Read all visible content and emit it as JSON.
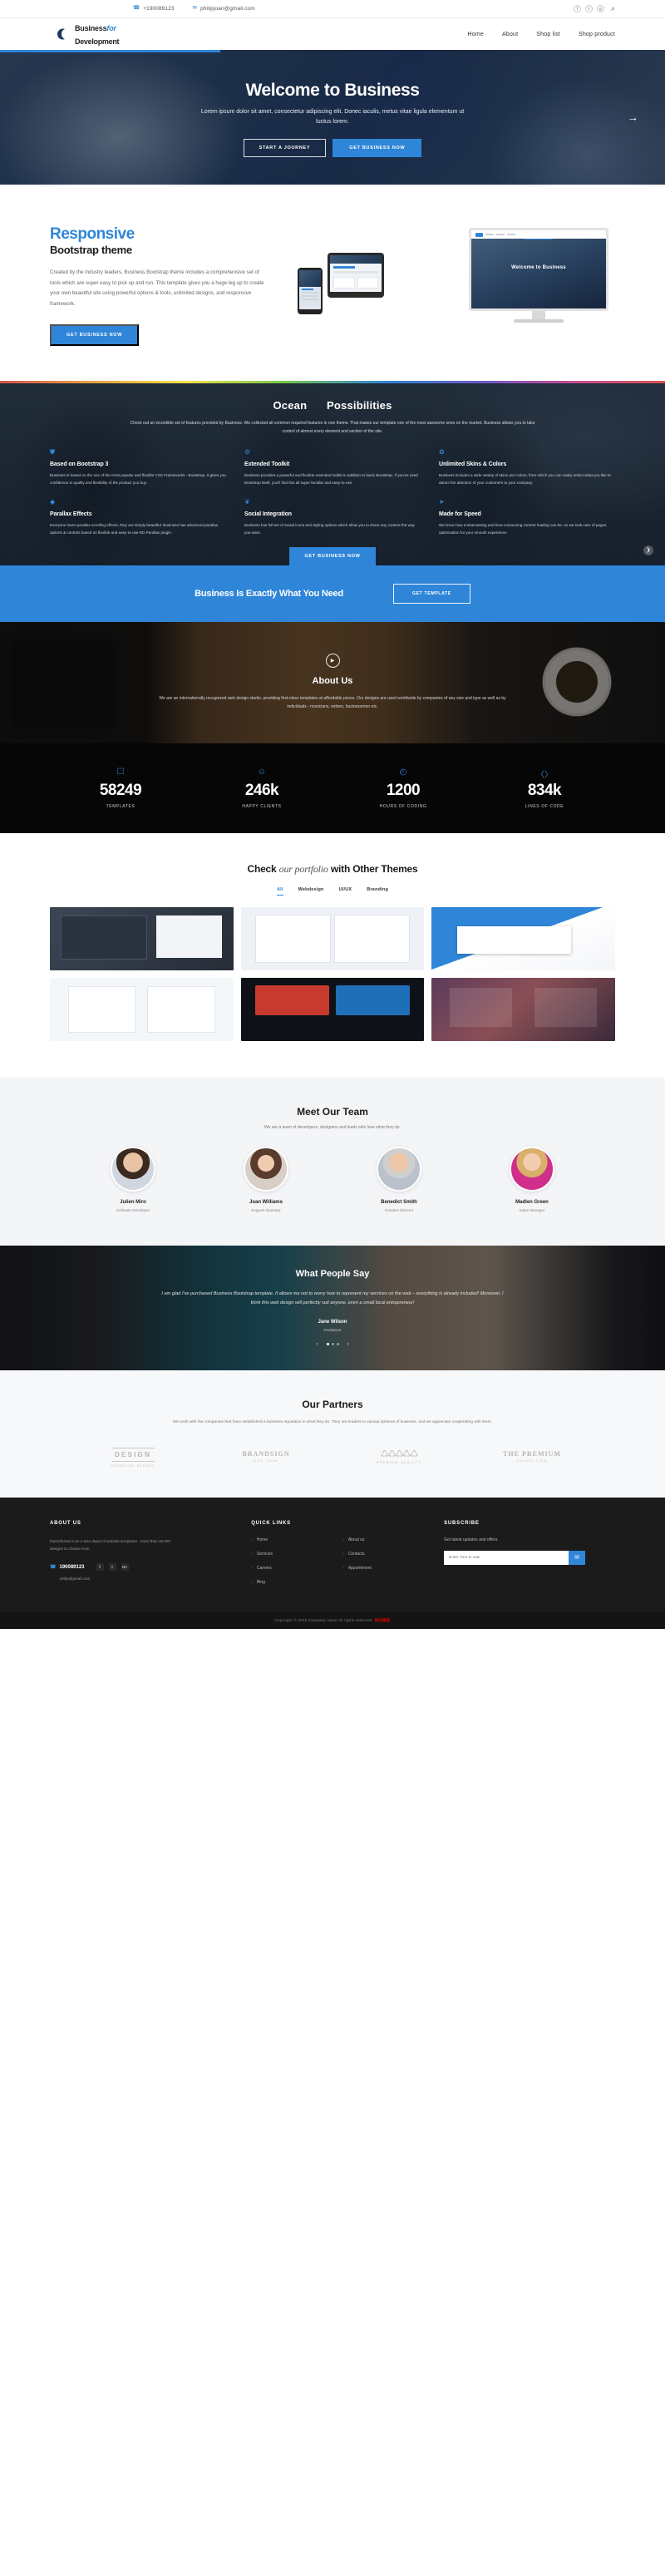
{
  "topbar": {
    "phone": "+190089123",
    "email": "philipjoan@gmail.com",
    "phone_icon": "phone-icon",
    "mail_icon": "envelope-icon",
    "socials": [
      {
        "name": "facebook",
        "glyph": "f"
      },
      {
        "name": "twitter",
        "glyph": "t"
      },
      {
        "name": "google-plus",
        "glyph": "g"
      }
    ],
    "search_glyph": "⌕"
  },
  "nav": {
    "brand_line1": "Business",
    "brand_italic": "for",
    "brand_line2": "Development",
    "links": [
      "Home",
      "About",
      "Shop list",
      "Shop product"
    ]
  },
  "hero": {
    "title": "Welcome to Business",
    "subtitle": "Lorem ipsum dolor sit amet, consectetur adipiscing elit. Donec iaculis, metus vitae ligula elementum ut luctus lorem.",
    "btn_ghost": "START A JOURNEY",
    "btn_primary": "GET BUSINESS NOW",
    "arrow_glyph": "→"
  },
  "responsive": {
    "title_blue": "Responsive",
    "title_dark": "Bootstrap theme",
    "paragraph": "Created by the industry leaders, Business Bootstrap theme includes a comprehensive set of tools which are super easy to pick up and run. This template gives you a huge leg up to create your own beautiful site using powerful options & tools, unlimited designs, and responsive framework.",
    "button": "GET BUSINESS NOW",
    "monitor_caption": "Welcome to Business"
  },
  "ocean": {
    "title_a": "Ocean",
    "title_b": "Possibilities",
    "subtitle": "Check out an incredible set of features provided by Business. We collected all common required features in one theme. That makes our template one of the most awesome ones on the market. Business allows you to take control of almost every element and section of the site.",
    "button": "GET BUSINESS NOW",
    "scroll_glyph": "❯",
    "features": [
      {
        "icon": "shield-icon",
        "glyph": "⛊",
        "title": "Based on Bootstrap 3",
        "text": "Business is based on the one of the most popular and flexible CSS Frameworks - Bootstrap. It gives you confidence in quality and flexibility of the product you buy."
      },
      {
        "icon": "toolkit-icon",
        "glyph": "⚙",
        "title": "Extended Toolkit",
        "text": "Business provides a powerful and flexible extended toolkit in addition to basic Bootstrap. If you've used Bootstrap itself, you'll find this all super familiar and easy-to-use."
      },
      {
        "icon": "palette-icon",
        "glyph": "✿",
        "title": "Unlimited Skins & Colors",
        "text": "Business includes a wide variety of skins and colors, from which you can easily select what you like to attract the attention of your customers to your company."
      },
      {
        "icon": "layers-icon",
        "glyph": "◆",
        "title": "Parallax Effects",
        "text": "Everyone loves parallax scrolling effects, they are simply beautiful. Business has advanced parallax options & controls based on flexible and easy-to-use RD Parallax plugin."
      },
      {
        "icon": "share-icon",
        "glyph": "❦",
        "title": "Social Integration",
        "text": "Business has full set of social icons and styling options which allow you to share any content the way you want."
      },
      {
        "icon": "rocket-icon",
        "glyph": "➤",
        "title": "Made for Speed",
        "text": "We know how embarrassing and time-consuming content loading can be, so we took care of pages optimization for your smooth experience."
      }
    ]
  },
  "cta": {
    "title": "Business Is Exactly What You Need",
    "button": "GET TEMPLATE"
  },
  "about": {
    "play_icon": "play-icon",
    "play_glyph": "▶",
    "title": "About Us",
    "text": "We are an internationally recognized web design studio, providing first-class templates at affordable prices. Our designs are used worldwide by companies of any size and type as well as by individuals - musicians, writers, businessmen etc."
  },
  "counters": [
    {
      "icon": "mobile-icon",
      "glyph": "☐",
      "value": "58249",
      "label": "TEMPLATES"
    },
    {
      "icon": "smile-icon",
      "glyph": "☺",
      "value": "246k",
      "label": "HAPPY CLIENTS"
    },
    {
      "icon": "clock-icon",
      "glyph": "◴",
      "value": "1200",
      "label": "HOURS OF CODING"
    },
    {
      "icon": "code-icon",
      "glyph": "〈〉",
      "value": "834k",
      "label": "LINES OF CODE"
    }
  ],
  "portfolio": {
    "title_a": "Check",
    "title_i": "our portfolio",
    "title_b": "with Other Themes",
    "tabs": [
      "All",
      "Webdesign",
      "UI/UX",
      "Branding"
    ],
    "active_tab": "All",
    "items": [
      "item-1",
      "item-2",
      "item-3",
      "item-4",
      "item-5",
      "item-6"
    ]
  },
  "team": {
    "title": "Meet Our Team",
    "subtitle": "We are a team of developers, designers and leads who love what they do.",
    "members": [
      {
        "name": "Julien Miro",
        "role": "Software Developer"
      },
      {
        "name": "Joan Williams",
        "role": "Support Operator"
      },
      {
        "name": "Benedict Smith",
        "role": "Creative Director"
      },
      {
        "name": "Madlen Green",
        "role": "Sales Manager"
      }
    ]
  },
  "testimonial": {
    "title": "What People Say",
    "quote": "I am glad I've purchased Business Bootstrap template. It allows me not to worry how to represent my services on the web – everything is already included! Moreover, I think this web design will perfectly suit anyone, even a small local entrepreneur!",
    "author": "Jane Wilson",
    "role": "Freelancer",
    "prev_glyph": "‹",
    "next_glyph": "›"
  },
  "partners": {
    "title": "Our Partners",
    "subtitle": "We work with the companies that have established a business reputation in what they do. They are leaders in various spheres of business, and we appreciate cooperating with them.",
    "logos": [
      {
        "name": "DESIGN",
        "sub": "CREATIVE STUDIO",
        "style": "rule"
      },
      {
        "name": "BRANDSIGN",
        "sub": "EST. 1998",
        "style": "serif"
      },
      {
        "name": "LAUREL",
        "sub": "PREMIUM QUALITY",
        "style": "laurel"
      },
      {
        "name": "THE PREMIUM",
        "sub": "COLLECTION",
        "style": "plain"
      }
    ]
  },
  "footer": {
    "about": {
      "heading": "ABOUT US",
      "text": "themeforest is an A-size depot of website templates - more than 46,000 designs to choose from.",
      "phone": "190089123",
      "phone_icon": "phone-icon",
      "email": "philip@gmail.com",
      "socials": [
        {
          "name": "facebook",
          "glyph": "f"
        },
        {
          "name": "twitter",
          "glyph": "t"
        },
        {
          "name": "google-plus",
          "glyph": "G+"
        }
      ]
    },
    "quick_links": {
      "heading": "QUICK LINKS",
      "col1": [
        "Home",
        "Services",
        "Careers",
        "Blog"
      ],
      "col2": [
        "About us",
        "Contacts",
        "Appointment"
      ],
      "chevron_glyph": "›"
    },
    "subscribe": {
      "heading": "SUBSCRIBE",
      "text": "Get latest updates and offers.",
      "placeholder": "Enter Your E-mail",
      "value": "",
      "button_icon": "envelope-icon",
      "button_glyph": "✉"
    },
    "copyright": "Copyright © 2018 Company name All rights reserved",
    "copyright_mark": "网站模板"
  }
}
